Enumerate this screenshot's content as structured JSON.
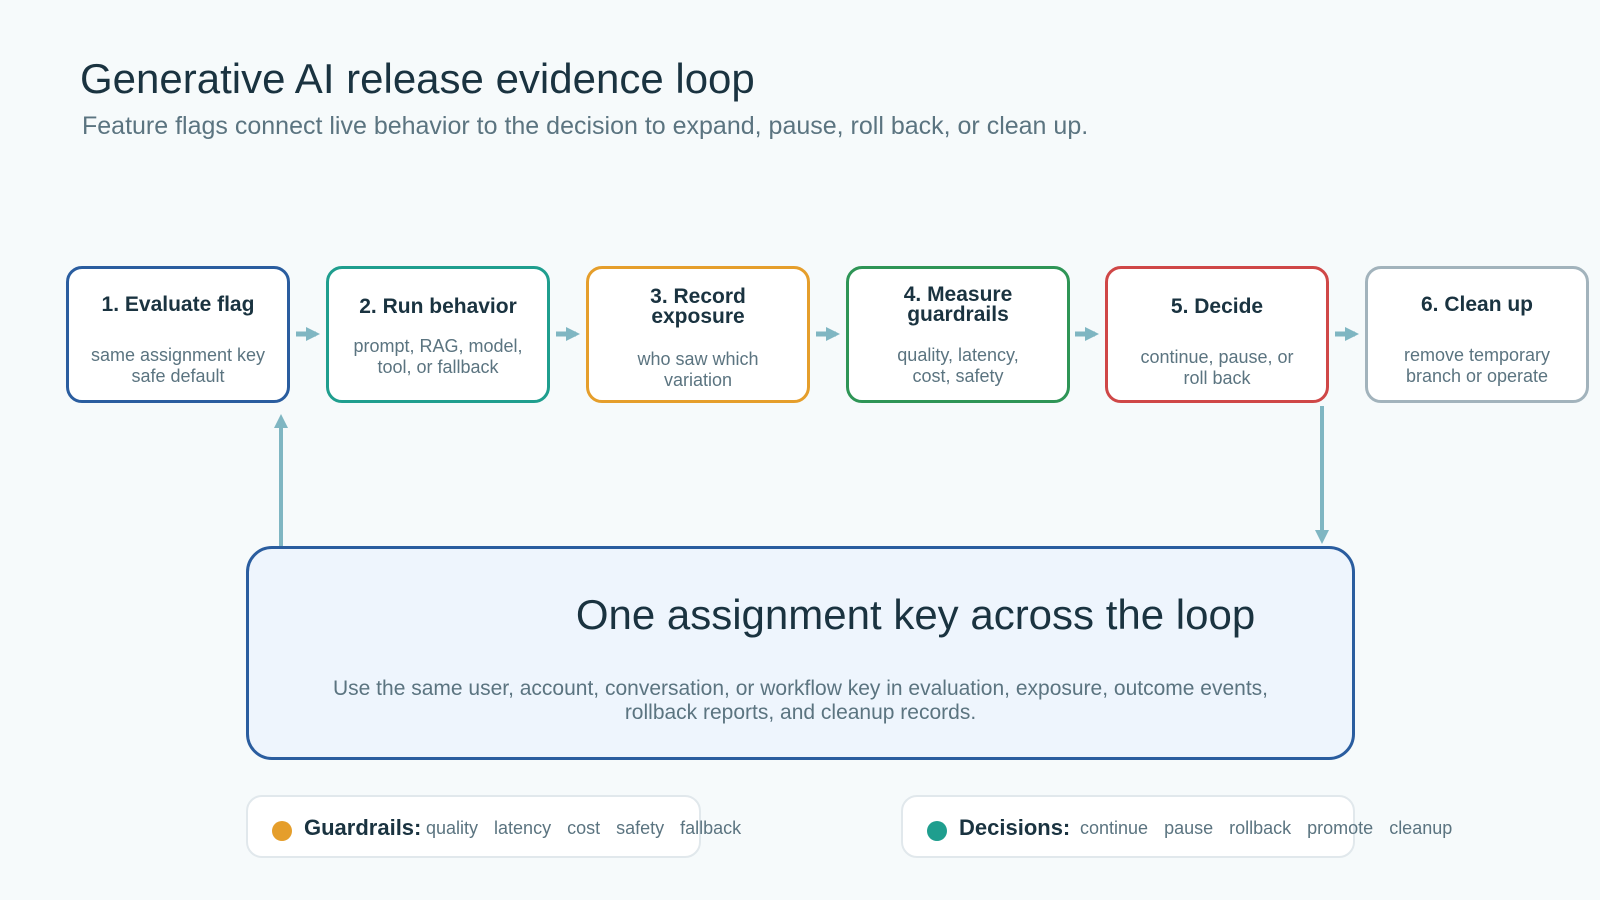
{
  "header": {
    "title": "Generative AI release evidence loop",
    "subtitle": "Feature flags connect live behavior to the decision to expand, pause, roll back, or clean up."
  },
  "steps": [
    {
      "title": "1. Evaluate flag",
      "desc": "same assignment key safe default",
      "color": "#2a5d9f"
    },
    {
      "title": "2. Run behavior",
      "desc": "prompt, RAG, model, tool, or fallback",
      "color": "#1f9e8e"
    },
    {
      "title": "3. Record exposure",
      "desc": "who saw which variation",
      "color": "#e59e2b"
    },
    {
      "title": "4. Measure guardrails",
      "desc": "quality, latency, cost, safety",
      "color": "#2e9556"
    },
    {
      "title": "5. Decide",
      "desc": "continue, pause, or roll back",
      "color": "#cf4747"
    },
    {
      "title": "6. Clean up",
      "desc": "remove temporary branch or operate",
      "color": "#a2b3bc"
    }
  ],
  "center": {
    "title": "One assignment key across the loop",
    "desc": "Use the same user, account, conversation, or workflow key in evaluation, exposure, outcome events, rollback reports, and cleanup records."
  },
  "legends": {
    "guardrails": {
      "label": "Guardrails:",
      "color": "#e59e2b",
      "items": [
        "quality",
        "latency",
        "cost",
        "safety",
        "fallback"
      ]
    },
    "decisions": {
      "label": "Decisions:",
      "color": "#1f9e8e",
      "items": [
        "continue",
        "pause",
        "rollback",
        "promote",
        "cleanup"
      ]
    }
  },
  "colors": {
    "arrow": "#7fb6c2",
    "accent": "#2a5d9f"
  }
}
